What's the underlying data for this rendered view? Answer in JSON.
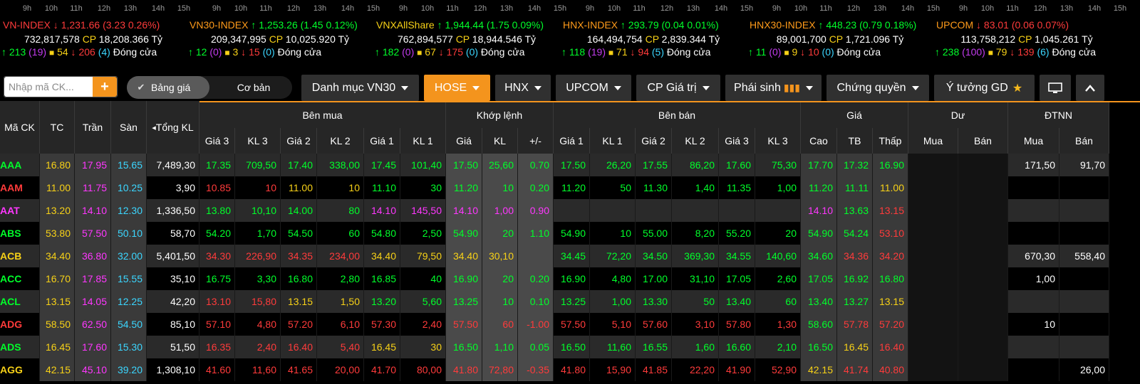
{
  "indices": [
    {
      "name": "VN-INDEX",
      "color": "red",
      "arrow": "down",
      "value": "1,231.66",
      "change": "(3.23 0.26%)",
      "volume": "732,817,578",
      "cp_label": "CP",
      "cp_value": "18,208.366",
      "unit": "Tỷ",
      "up": "213",
      "up_paren": "(19)",
      "flat": "54",
      "down": "206",
      "down_paren": "(4)",
      "status": "Đóng cửa"
    },
    {
      "name": "VN30-INDEX",
      "color": "green",
      "arrow": "up",
      "value": "1,253.26",
      "change": "(1.45 0.12%)",
      "volume": "209,347,995",
      "cp_label": "CP",
      "cp_value": "10,025.920",
      "unit": "Tỷ",
      "up": "12",
      "up_paren": "(0)",
      "flat": "3",
      "down": "15",
      "down_paren": "(0)",
      "status": "Đóng cửa"
    },
    {
      "name": "VNXAllShare",
      "color": "green",
      "arrow": "up",
      "value": "1,944.44",
      "change": "(1.75 0.09%)",
      "volume": "762,894,577",
      "cp_label": "CP",
      "cp_value": "18,944.546",
      "unit": "Tỷ",
      "up": "182",
      "up_paren": "(0)",
      "flat": "67",
      "down": "175",
      "down_paren": "(0)",
      "status": "Đóng cửa"
    },
    {
      "name": "HNX-INDEX",
      "color": "green",
      "arrow": "up",
      "value": "293.79",
      "change": "(0.04 0.01%)",
      "volume": "164,494,754",
      "cp_label": "CP",
      "cp_value": "2,839.344",
      "unit": "Tỷ",
      "up": "118",
      "up_paren": "(19)",
      "flat": "71",
      "down": "94",
      "down_paren": "(5)",
      "status": "Đóng cửa"
    },
    {
      "name": "HNX30-INDEX",
      "color": "green",
      "arrow": "up",
      "value": "448.23",
      "change": "(0.79 0.18%)",
      "volume": "89,001,700",
      "cp_label": "CP",
      "cp_value": "1,721.096",
      "unit": "Tỷ",
      "up": "11",
      "up_paren": "(0)",
      "flat": "9",
      "down": "10",
      "down_paren": "(0)",
      "status": "Đóng cửa"
    },
    {
      "name": "UPCOM",
      "color": "red",
      "arrow": "down",
      "value": "83.01",
      "change": "(0.06 0.07%)",
      "volume": "113,758,212",
      "cp_label": "CP",
      "cp_value": "1,045.261",
      "unit": "Tỷ",
      "up": "238",
      "up_paren": "(100)",
      "flat": "79",
      "down": "139",
      "down_paren": "(6)",
      "status": "Đóng cửa"
    }
  ],
  "hours": [
    "9h",
    "10h",
    "11h",
    "12h",
    "13h",
    "14h",
    "15h"
  ],
  "toolbar": {
    "search_placeholder": "Nhập mã CK...",
    "toggle_on": "Bảng giá",
    "toggle_off": "Cơ bản",
    "tabs": [
      "Danh mục VN30",
      "HOSE",
      "HNX",
      "UPCOM",
      "CP Giá trị",
      "Phái sinh",
      "Chứng quyền",
      "Ý tưởng GD"
    ]
  },
  "headers": {
    "symbol": "Mã CK",
    "ref": "TC",
    "ceil": "Trần",
    "floor": "Sàn",
    "total_vol": "Tổng KL",
    "buy_group": "Bên mua",
    "match_group": "Khớp lệnh",
    "sell_group": "Bên bán",
    "price_group": "Giá",
    "remain_group": "Dư",
    "foreign_group": "ĐTNN",
    "buy_cols": [
      "Giá 3",
      "KL 3",
      "Giá 2",
      "KL 2",
      "Giá 1",
      "KL 1"
    ],
    "match_cols": [
      "Giá",
      "KL",
      "+/-"
    ],
    "sell_cols": [
      "Giá 1",
      "KL 1",
      "Giá 2",
      "KL 2",
      "Giá 3",
      "KL 3"
    ],
    "price_cols": [
      "Cao",
      "TB",
      "Thấp"
    ],
    "remain_cols": [
      "Mua",
      "Bán"
    ],
    "foreign_cols": [
      "Mua",
      "Bán"
    ]
  },
  "rows": [
    {
      "sym": [
        "AAA",
        "up"
      ],
      "tc": "16.80",
      "tran": "17.95",
      "san": "15.65",
      "tkl": "7,489,30",
      "b": [
        [
          "17.35",
          "up"
        ],
        [
          "709,50",
          "up"
        ],
        [
          "17.40",
          "up"
        ],
        [
          "338,00",
          "up"
        ],
        [
          "17.45",
          "up"
        ],
        [
          "101,40",
          "up"
        ]
      ],
      "m": [
        [
          "17.50",
          "up"
        ],
        [
          "25,60",
          "up"
        ],
        [
          "0.70",
          "up"
        ]
      ],
      "s": [
        [
          "17.50",
          "up"
        ],
        [
          "26,20",
          "up"
        ],
        [
          "17.55",
          "up"
        ],
        [
          "86,20",
          "up"
        ],
        [
          "17.60",
          "up"
        ],
        [
          "75,30",
          "up"
        ]
      ],
      "p": [
        [
          "17.70",
          "up"
        ],
        [
          "17.32",
          "up"
        ],
        [
          "16.90",
          "up"
        ]
      ],
      "r": [
        "",
        ""
      ],
      "f": [
        "171,50",
        "91,70"
      ]
    },
    {
      "sym": [
        "AAM",
        "down"
      ],
      "tc": "11.00",
      "tran": "11.75",
      "san": "10.25",
      "tkl": "3,90",
      "b": [
        [
          "10.85",
          "down"
        ],
        [
          "10",
          "down"
        ],
        [
          "11.00",
          "ref"
        ],
        [
          "10",
          "ref"
        ],
        [
          "11.10",
          "up"
        ],
        [
          "30",
          "up"
        ]
      ],
      "m": [
        [
          "11.20",
          "up"
        ],
        [
          "10",
          "up"
        ],
        [
          "0.20",
          "up"
        ]
      ],
      "s": [
        [
          "11.20",
          "up"
        ],
        [
          "50",
          "up"
        ],
        [
          "11.30",
          "up"
        ],
        [
          "1,40",
          "up"
        ],
        [
          "11.35",
          "up"
        ],
        [
          "1,00",
          "up"
        ]
      ],
      "p": [
        [
          "11.20",
          "up"
        ],
        [
          "11.11",
          "up"
        ],
        [
          "11.00",
          "ref"
        ]
      ],
      "r": [
        "",
        ""
      ],
      "f": [
        "",
        ""
      ]
    },
    {
      "sym": [
        "AAT",
        "ceil"
      ],
      "tc": "13.20",
      "tran": "14.10",
      "san": "12.30",
      "tkl": "1,336,50",
      "b": [
        [
          "13.80",
          "up"
        ],
        [
          "10,10",
          "up"
        ],
        [
          "14.00",
          "up"
        ],
        [
          "80",
          "up"
        ],
        [
          "14.10",
          "ceil"
        ],
        [
          "145,50",
          "ceil"
        ]
      ],
      "m": [
        [
          "14.10",
          "ceil"
        ],
        [
          "1,00",
          "ceil"
        ],
        [
          "0.90",
          "ceil"
        ]
      ],
      "s": [
        [
          "",
          ""
        ],
        [
          "",
          ""
        ],
        [
          "",
          ""
        ],
        [
          "",
          ""
        ],
        [
          "",
          ""
        ],
        [
          "",
          ""
        ]
      ],
      "p": [
        [
          "14.10",
          "ceil"
        ],
        [
          "13.63",
          "up"
        ],
        [
          "13.15",
          "down"
        ]
      ],
      "r": [
        "",
        ""
      ],
      "f": [
        "",
        ""
      ]
    },
    {
      "sym": [
        "ABS",
        "up"
      ],
      "tc": "53.80",
      "tran": "57.50",
      "san": "50.10",
      "tkl": "58,70",
      "b": [
        [
          "54.20",
          "up"
        ],
        [
          "1,70",
          "up"
        ],
        [
          "54.50",
          "up"
        ],
        [
          "60",
          "up"
        ],
        [
          "54.80",
          "up"
        ],
        [
          "2,50",
          "up"
        ]
      ],
      "m": [
        [
          "54.90",
          "up"
        ],
        [
          "20",
          "up"
        ],
        [
          "1.10",
          "up"
        ]
      ],
      "s": [
        [
          "54.90",
          "up"
        ],
        [
          "10",
          "up"
        ],
        [
          "55.00",
          "up"
        ],
        [
          "8,20",
          "up"
        ],
        [
          "55.20",
          "up"
        ],
        [
          "20",
          "up"
        ]
      ],
      "p": [
        [
          "54.90",
          "up"
        ],
        [
          "54.24",
          "up"
        ],
        [
          "53.10",
          "down"
        ]
      ],
      "r": [
        "",
        ""
      ],
      "f": [
        "",
        ""
      ]
    },
    {
      "sym": [
        "ACB",
        "ref"
      ],
      "tc": "34.40",
      "tran": "36.80",
      "san": "32.00",
      "tkl": "5,401,50",
      "b": [
        [
          "34.30",
          "down"
        ],
        [
          "226,90",
          "down"
        ],
        [
          "34.35",
          "down"
        ],
        [
          "234,00",
          "down"
        ],
        [
          "34.40",
          "ref"
        ],
        [
          "79,50",
          "ref"
        ]
      ],
      "m": [
        [
          "34.40",
          "ref"
        ],
        [
          "30,10",
          "ref"
        ],
        [
          "",
          ""
        ]
      ],
      "s": [
        [
          "34.45",
          "up"
        ],
        [
          "72,20",
          "up"
        ],
        [
          "34.50",
          "up"
        ],
        [
          "369,30",
          "up"
        ],
        [
          "34.55",
          "up"
        ],
        [
          "140,60",
          "up"
        ]
      ],
      "p": [
        [
          "34.60",
          "up"
        ],
        [
          "34.36",
          "down"
        ],
        [
          "34.20",
          "down"
        ]
      ],
      "r": [
        "",
        ""
      ],
      "f": [
        "670,30",
        "558,40"
      ]
    },
    {
      "sym": [
        "ACC",
        "up"
      ],
      "tc": "16.70",
      "tran": "17.85",
      "san": "15.55",
      "tkl": "35,10",
      "b": [
        [
          "16.75",
          "up"
        ],
        [
          "3,30",
          "up"
        ],
        [
          "16.80",
          "up"
        ],
        [
          "2,80",
          "up"
        ],
        [
          "16.85",
          "up"
        ],
        [
          "40",
          "up"
        ]
      ],
      "m": [
        [
          "16.90",
          "up"
        ],
        [
          "20",
          "up"
        ],
        [
          "0.20",
          "up"
        ]
      ],
      "s": [
        [
          "16.90",
          "up"
        ],
        [
          "4,80",
          "up"
        ],
        [
          "17.00",
          "up"
        ],
        [
          "31,10",
          "up"
        ],
        [
          "17.05",
          "up"
        ],
        [
          "2,60",
          "up"
        ]
      ],
      "p": [
        [
          "17.05",
          "up"
        ],
        [
          "16.92",
          "up"
        ],
        [
          "16.80",
          "up"
        ]
      ],
      "r": [
        "",
        ""
      ],
      "f": [
        "1,00",
        ""
      ]
    },
    {
      "sym": [
        "ACL",
        "up"
      ],
      "tc": "13.15",
      "tran": "14.05",
      "san": "12.25",
      "tkl": "42,20",
      "b": [
        [
          "13.10",
          "down"
        ],
        [
          "15,80",
          "down"
        ],
        [
          "13.15",
          "ref"
        ],
        [
          "1,50",
          "ref"
        ],
        [
          "13.20",
          "up"
        ],
        [
          "5,60",
          "up"
        ]
      ],
      "m": [
        [
          "13.25",
          "up"
        ],
        [
          "10",
          "up"
        ],
        [
          "0.10",
          "up"
        ]
      ],
      "s": [
        [
          "13.25",
          "up"
        ],
        [
          "1,00",
          "up"
        ],
        [
          "13.30",
          "up"
        ],
        [
          "50",
          "up"
        ],
        [
          "13.40",
          "up"
        ],
        [
          "60",
          "up"
        ]
      ],
      "p": [
        [
          "13.40",
          "up"
        ],
        [
          "13.27",
          "up"
        ],
        [
          "13.15",
          "ref"
        ]
      ],
      "r": [
        "",
        ""
      ],
      "f": [
        "",
        ""
      ]
    },
    {
      "sym": [
        "ADG",
        "down"
      ],
      "tc": "58.50",
      "tran": "62.50",
      "san": "54.50",
      "tkl": "85,10",
      "b": [
        [
          "57.10",
          "down"
        ],
        [
          "4,80",
          "down"
        ],
        [
          "57.20",
          "down"
        ],
        [
          "6,10",
          "down"
        ],
        [
          "57.30",
          "down"
        ],
        [
          "2,40",
          "down"
        ]
      ],
      "m": [
        [
          "57.50",
          "down"
        ],
        [
          "60",
          "down"
        ],
        [
          "-1.00",
          "down"
        ]
      ],
      "s": [
        [
          "57.50",
          "down"
        ],
        [
          "5,10",
          "down"
        ],
        [
          "57.60",
          "down"
        ],
        [
          "3,10",
          "down"
        ],
        [
          "57.80",
          "down"
        ],
        [
          "1,30",
          "down"
        ]
      ],
      "p": [
        [
          "58.60",
          "up"
        ],
        [
          "57.78",
          "down"
        ],
        [
          "57.20",
          "down"
        ]
      ],
      "r": [
        "",
        ""
      ],
      "f": [
        "10",
        ""
      ]
    },
    {
      "sym": [
        "ADS",
        "up"
      ],
      "tc": "16.45",
      "tran": "17.60",
      "san": "15.30",
      "tkl": "51,50",
      "b": [
        [
          "16.35",
          "down"
        ],
        [
          "2,40",
          "down"
        ],
        [
          "16.40",
          "down"
        ],
        [
          "5,40",
          "down"
        ],
        [
          "16.45",
          "ref"
        ],
        [
          "30",
          "ref"
        ]
      ],
      "m": [
        [
          "16.50",
          "up"
        ],
        [
          "1,10",
          "up"
        ],
        [
          "0.05",
          "up"
        ]
      ],
      "s": [
        [
          "16.50",
          "up"
        ],
        [
          "11,60",
          "up"
        ],
        [
          "16.55",
          "up"
        ],
        [
          "1,60",
          "up"
        ],
        [
          "16.60",
          "up"
        ],
        [
          "2,10",
          "up"
        ]
      ],
      "p": [
        [
          "16.50",
          "up"
        ],
        [
          "16.45",
          "ref"
        ],
        [
          "16.40",
          "down"
        ]
      ],
      "r": [
        "",
        ""
      ],
      "f": [
        "",
        ""
      ]
    },
    {
      "sym": [
        "AGG",
        "ref"
      ],
      "tc": "42.15",
      "tran": "45.10",
      "san": "39.20",
      "tkl": "1,308,10",
      "b": [
        [
          "41.60",
          "down"
        ],
        [
          "11,60",
          "down"
        ],
        [
          "41.65",
          "down"
        ],
        [
          "20,00",
          "down"
        ],
        [
          "41.70",
          "down"
        ],
        [
          "80,00",
          "down"
        ]
      ],
      "m": [
        [
          "41.80",
          "down"
        ],
        [
          "72,80",
          "down"
        ],
        [
          "-0.35",
          "down"
        ]
      ],
      "s": [
        [
          "41.80",
          "down"
        ],
        [
          "15,90",
          "down"
        ],
        [
          "41.85",
          "down"
        ],
        [
          "22,20",
          "down"
        ],
        [
          "41.90",
          "down"
        ],
        [
          "52,90",
          "down"
        ]
      ],
      "p": [
        [
          "42.15",
          "ref"
        ],
        [
          "41.74",
          "down"
        ],
        [
          "40.80",
          "down"
        ]
      ],
      "r": [
        "",
        ""
      ],
      "f": [
        "",
        "26,00"
      ]
    }
  ],
  "colors": {
    "up": "#00ff2a",
    "down": "#ff3b3b",
    "ref": "#f7d117",
    "ceil": "#ff37ff",
    "floor": "#3bd6ff",
    "accent": "#f4941d"
  }
}
